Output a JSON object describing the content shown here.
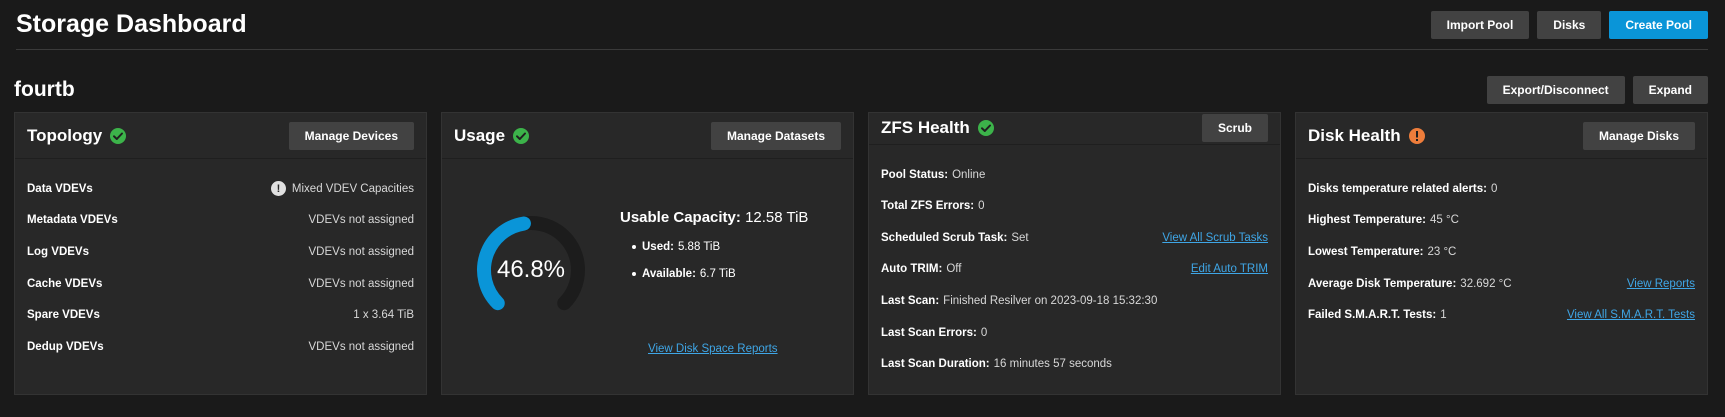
{
  "header": {
    "title": "Storage Dashboard",
    "import_pool": "Import Pool",
    "disks": "Disks",
    "create_pool": "Create Pool"
  },
  "pool": {
    "name": "fourtb",
    "export_disconnect": "Export/Disconnect",
    "expand": "Expand"
  },
  "colors": {
    "accent": "#0a95d8",
    "ok": "#3cb34a",
    "warning": "#ee7d3b",
    "link": "#3fa6e6"
  },
  "topology": {
    "title": "Topology",
    "status_icon": "check-circle-icon",
    "button": "Manage Devices",
    "rows": [
      {
        "label": "Data VDEVs",
        "value": "Mixed VDEV Capacities",
        "icon": "info-icon"
      },
      {
        "label": "Metadata VDEVs",
        "value": "VDEVs not assigned"
      },
      {
        "label": "Log VDEVs",
        "value": "VDEVs not assigned"
      },
      {
        "label": "Cache VDEVs",
        "value": "VDEVs not assigned"
      },
      {
        "label": "Spare VDEVs",
        "value": "1 x 3.64 TiB"
      },
      {
        "label": "Dedup VDEVs",
        "value": "VDEVs not assigned"
      }
    ]
  },
  "usage": {
    "title": "Usage",
    "status_icon": "check-circle-icon",
    "button": "Manage Datasets",
    "percent_text": "46.8%",
    "percent": 46.8,
    "usable_label": "Usable Capacity:",
    "usable_value": "12.58 TiB",
    "used_label": "Used:",
    "used_value": "5.88 TiB",
    "available_label": "Available:",
    "available_value": "6.7 TiB",
    "link": "View Disk Space Reports"
  },
  "zfs": {
    "title": "ZFS Health",
    "status_icon": "check-circle-icon",
    "button": "Scrub",
    "rows": [
      {
        "label": "Pool Status:",
        "value": "Online"
      },
      {
        "label": "Total ZFS Errors:",
        "value": "0"
      },
      {
        "label": "Scheduled Scrub Task:",
        "value": "Set",
        "link": "View All Scrub Tasks"
      },
      {
        "label": "Auto TRIM:",
        "value": "Off",
        "link": "Edit Auto TRIM"
      },
      {
        "label": "Last Scan:",
        "value": "Finished Resilver on 2023-09-18 15:32:30"
      },
      {
        "label": "Last Scan Errors:",
        "value": "0"
      },
      {
        "label": "Last Scan Duration:",
        "value": "16 minutes 57 seconds"
      }
    ]
  },
  "disk_health": {
    "title": "Disk Health",
    "status_icon": "alert-circle-icon",
    "button": "Manage Disks",
    "rows": [
      {
        "label": "Disks temperature related alerts:",
        "value": "0"
      },
      {
        "label": "Highest Temperature:",
        "value": "45 °C"
      },
      {
        "label": "Lowest Temperature:",
        "value": "23 °C"
      },
      {
        "label": "Average Disk Temperature:",
        "value": "32.692 °C",
        "link": "View Reports"
      },
      {
        "label": "Failed S.M.A.R.T. Tests:",
        "value": "1",
        "link": "View All S.M.A.R.T. Tests"
      }
    ]
  }
}
